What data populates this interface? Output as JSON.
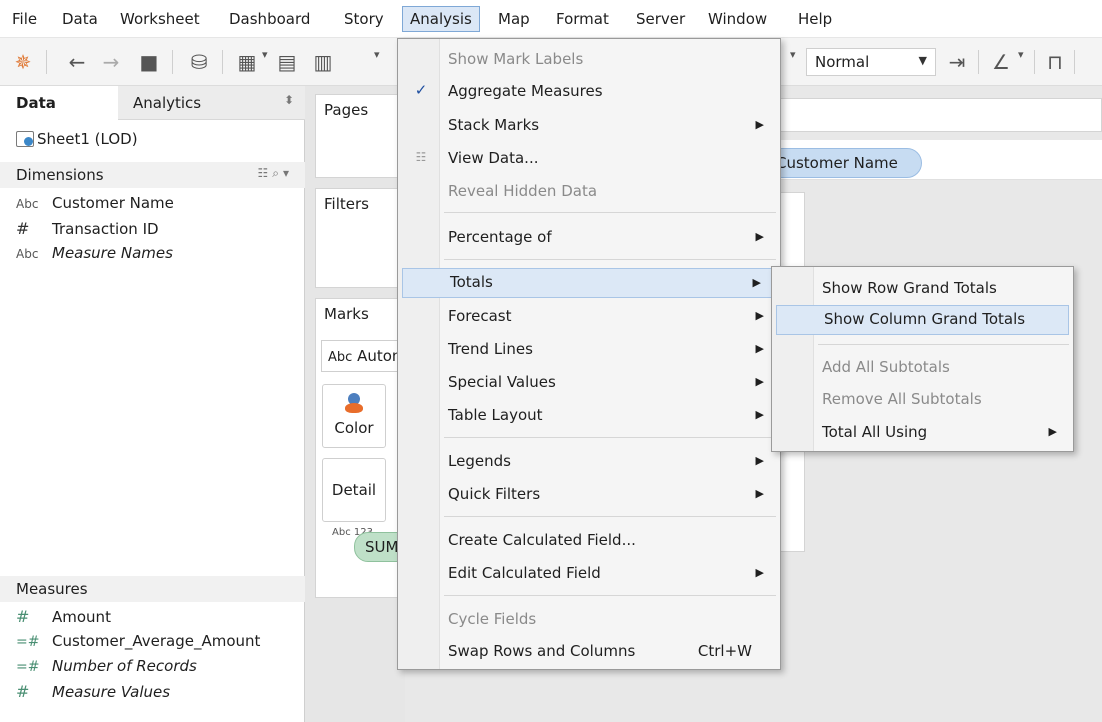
{
  "menubar": {
    "items": [
      {
        "label": "File"
      },
      {
        "label": "Data"
      },
      {
        "label": "Worksheet"
      },
      {
        "label": "Dashboard"
      },
      {
        "label": "Story"
      },
      {
        "label": "Analysis"
      },
      {
        "label": "Map"
      },
      {
        "label": "Format"
      },
      {
        "label": "Server"
      },
      {
        "label": "Window"
      },
      {
        "label": "Help"
      }
    ],
    "active": "Analysis"
  },
  "toolbar": {
    "view_select": "Normal"
  },
  "data_pane": {
    "tabs": {
      "data": "Data",
      "analytics": "Analytics"
    },
    "datasource": "Sheet1 (LOD)",
    "dimensions_header": "Dimensions",
    "dimensions": [
      {
        "type": "Abc",
        "name": "Customer Name",
        "italic": false
      },
      {
        "type": "#",
        "name": "Transaction ID",
        "italic": false
      },
      {
        "type": "Abc",
        "name": "Measure Names",
        "italic": true
      }
    ],
    "measures_header": "Measures",
    "measures": [
      {
        "type": "#",
        "name": "Amount",
        "italic": false
      },
      {
        "type": "=#",
        "name": "Customer_Average_Amount",
        "italic": false
      },
      {
        "type": "=#",
        "name": "Number of Records",
        "italic": true
      },
      {
        "type": "#",
        "name": "Measure Values",
        "italic": true
      }
    ]
  },
  "cards": {
    "pages": "Pages",
    "filters": "Filters",
    "marks": "Marks",
    "mark_type": "Automatic",
    "mark_type_icon": "Abc",
    "color": "Color",
    "detail": "Detail",
    "text_pill": "SUM(Customer_Average_Amount)",
    "text_pill_icon": "Abc 123"
  },
  "viz": {
    "rows_pill": "Customer Name"
  },
  "analysis_menu": {
    "items": [
      {
        "label": "Show Mark Labels",
        "disabled": true,
        "submenu": false,
        "checked": false
      },
      {
        "label": "Aggregate Measures",
        "disabled": false,
        "submenu": false,
        "checked": true
      },
      {
        "label": "Stack Marks",
        "disabled": false,
        "submenu": true,
        "checked": false
      },
      {
        "label": "View Data...",
        "disabled": false,
        "submenu": false,
        "checked": false
      },
      {
        "label": "Reveal Hidden Data",
        "disabled": true,
        "submenu": false,
        "checked": false
      },
      {
        "label": "Percentage of",
        "disabled": false,
        "submenu": true,
        "checked": false
      },
      {
        "label": "Totals",
        "disabled": false,
        "submenu": true,
        "checked": false,
        "highlighted": true
      },
      {
        "label": "Forecast",
        "disabled": false,
        "submenu": true,
        "checked": false
      },
      {
        "label": "Trend Lines",
        "disabled": false,
        "submenu": true,
        "checked": false
      },
      {
        "label": "Special Values",
        "disabled": false,
        "submenu": true,
        "checked": false
      },
      {
        "label": "Table Layout",
        "disabled": false,
        "submenu": true,
        "checked": false
      },
      {
        "label": "Legends",
        "disabled": false,
        "submenu": true,
        "checked": false
      },
      {
        "label": "Quick Filters",
        "disabled": false,
        "submenu": true,
        "checked": false
      },
      {
        "label": "Create Calculated Field...",
        "disabled": false,
        "submenu": false,
        "checked": false
      },
      {
        "label": "Edit Calculated Field",
        "disabled": false,
        "submenu": true,
        "checked": false
      },
      {
        "label": "Cycle Fields",
        "disabled": true,
        "submenu": false,
        "checked": false
      },
      {
        "label": "Swap Rows and Columns",
        "disabled": false,
        "submenu": false,
        "checked": false,
        "shortcut": "Ctrl+W"
      }
    ]
  },
  "totals_submenu": {
    "items": [
      {
        "label": "Show Row Grand Totals",
        "disabled": false,
        "submenu": false
      },
      {
        "label": "Show Column Grand Totals",
        "disabled": false,
        "submenu": false,
        "highlighted": true
      },
      {
        "label": "Add All Subtotals",
        "disabled": true,
        "submenu": false
      },
      {
        "label": "Remove All Subtotals",
        "disabled": true,
        "submenu": false
      },
      {
        "label": "Total All Using",
        "disabled": false,
        "submenu": true
      }
    ]
  },
  "colors": {
    "menu_highlight": "#dce8f6",
    "checkmark": "#1f4fa0",
    "measure_pill": "#bfe0c8",
    "dimension_pill": "#c7dcf2"
  }
}
